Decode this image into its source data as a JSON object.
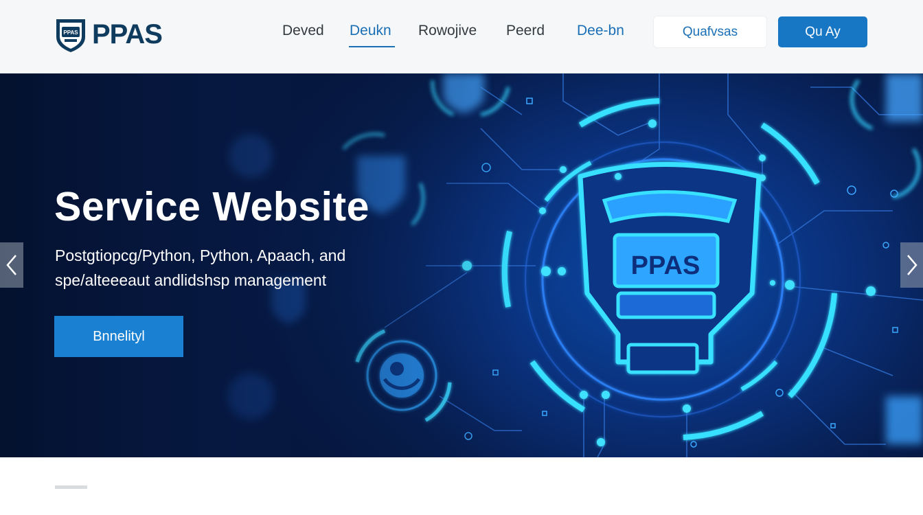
{
  "brand": {
    "name": "PPAS",
    "emblem_text": "PPAS"
  },
  "nav": {
    "items": [
      {
        "label": "Deved"
      },
      {
        "label": "Deukn",
        "active": true
      },
      {
        "label": "Rowojive"
      },
      {
        "label": "Peerd"
      },
      {
        "label": "Dee-bn"
      }
    ]
  },
  "header": {
    "outline_button": "Quafvsas",
    "primary_button": "Qu Ay"
  },
  "hero": {
    "title": "Service Website",
    "subtitle_line1": "Postgtiopcg/Python, Python, Apaach, and",
    "subtitle_line2": "spe/alteeeaut andlidshsp management",
    "cta": "Bnnelityl",
    "shield_text": "PPAS"
  },
  "carousel": {
    "prev_icon": "chevron-left-icon",
    "next_icon": "chevron-right-icon"
  },
  "colors": {
    "brand_dark": "#0f3b5f",
    "accent": "#1877c5",
    "glow": "#38e1ff",
    "hero_bg": "#071d4d"
  }
}
